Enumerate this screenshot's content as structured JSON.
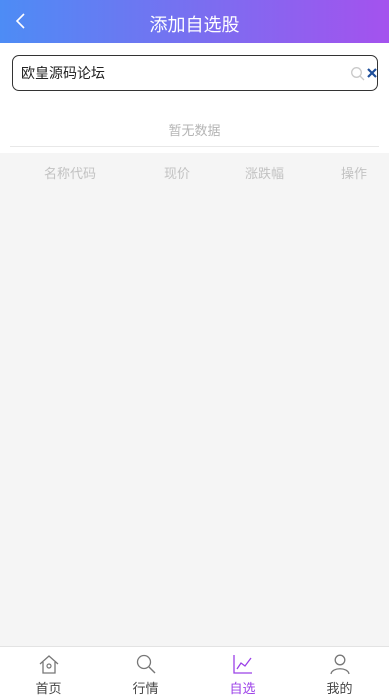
{
  "header": {
    "title": "添加自选股",
    "back_icon": "chevron-left-icon"
  },
  "search": {
    "value": "欧皇源码论坛",
    "search_icon": "search-icon",
    "clear_icon": "close-icon"
  },
  "empty_text": "暂无数据",
  "table": {
    "columns": [
      "名称代码",
      "现价",
      "涨跌幅",
      "操作"
    ]
  },
  "tabbar": {
    "items": [
      {
        "label": "首页",
        "icon": "home-icon"
      },
      {
        "label": "行情",
        "icon": "search-icon"
      },
      {
        "label": "自选",
        "icon": "line-chart-icon",
        "active": true
      },
      {
        "label": "我的",
        "icon": "user-icon"
      }
    ]
  },
  "colors": {
    "accent": "#9b40e8",
    "header_start": "#4d8cf5",
    "header_end": "#a452ee"
  }
}
